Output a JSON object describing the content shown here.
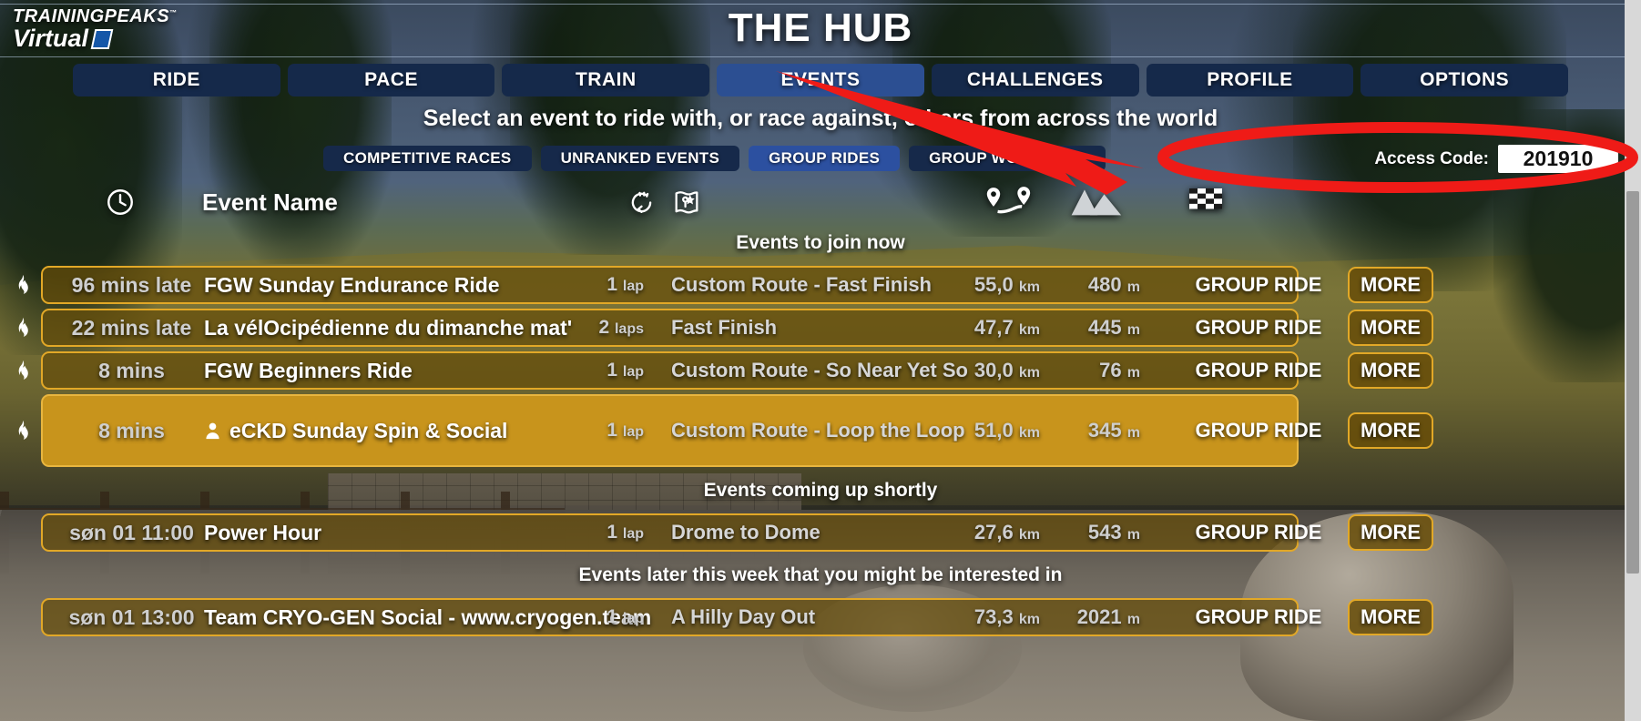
{
  "brand": {
    "name_top": "TRAININGPEAKS",
    "trademark": "™",
    "name_bottom": "Virtual",
    "mark_icon": "parallelogram-logo-mark"
  },
  "header": {
    "title": "THE HUB",
    "subtitle": "Select an event to ride with, or race against, others from across the world"
  },
  "nav": {
    "tabs": [
      {
        "label": "RIDE",
        "active": false
      },
      {
        "label": "PACE",
        "active": false
      },
      {
        "label": "TRAIN",
        "active": false
      },
      {
        "label": "EVENTS",
        "active": true
      },
      {
        "label": "CHALLENGES",
        "active": false
      },
      {
        "label": "PROFILE",
        "active": false
      },
      {
        "label": "OPTIONS",
        "active": false
      }
    ]
  },
  "filters": {
    "buttons": [
      {
        "label": "COMPETITIVE RACES",
        "active": false
      },
      {
        "label": "UNRANKED EVENTS",
        "active": false
      },
      {
        "label": "GROUP RIDES",
        "active": true
      },
      {
        "label": "GROUP WORKOUTS",
        "active": false
      }
    ]
  },
  "access_code": {
    "label": "Access Code:",
    "value": "201910",
    "placeholder": ""
  },
  "columns": {
    "time_icon": "clock-icon",
    "name": "Event Name",
    "laps_icon": "lap-loop-icon",
    "route_icon": "map-route-icon",
    "distance_icon": "distance-pins-icon",
    "elevation_icon": "mountain-elevation-icon",
    "type_icon": "checkered-flag-icon"
  },
  "sections": [
    {
      "heading": "Events to join now",
      "events": [
        {
          "time": "96 mins late",
          "name": "FGW Sunday Endurance Ride",
          "laps": "1",
          "laps_unit": "lap",
          "route": "Custom Route - Fast Finish",
          "distance": "55,0",
          "distance_unit": "km",
          "elevation": "480",
          "elevation_unit": "m",
          "type": "GROUP RIDE",
          "more": "MORE",
          "badge_icon": "flame-icon",
          "highlighted": false,
          "private": false
        },
        {
          "time": "22 mins late",
          "name": "La vélOcipédienne du dimanche mat'",
          "laps": "2",
          "laps_unit": "laps",
          "route": "Fast Finish",
          "distance": "47,7",
          "distance_unit": "km",
          "elevation": "445",
          "elevation_unit": "m",
          "type": "GROUP RIDE",
          "more": "MORE",
          "badge_icon": "flame-icon",
          "highlighted": false,
          "private": false
        },
        {
          "time": "8 mins",
          "name": "FGW Beginners Ride",
          "laps": "1",
          "laps_unit": "lap",
          "route": "Custom Route - So Near Yet So Far",
          "distance": "30,0",
          "distance_unit": "km",
          "elevation": "76",
          "elevation_unit": "m",
          "type": "GROUP RIDE",
          "more": "MORE",
          "badge_icon": "flame-icon",
          "highlighted": false,
          "private": false
        },
        {
          "time": "8 mins",
          "name": "eCKD Sunday Spin & Social",
          "laps": "1",
          "laps_unit": "lap",
          "route": "Custom Route - Loop the Loop",
          "distance": "51,0",
          "distance_unit": "km",
          "elevation": "345",
          "elevation_unit": "m",
          "type": "GROUP RIDE",
          "more": "MORE",
          "badge_icon": "flame-icon",
          "highlighted": true,
          "private": true,
          "private_icon": "person-icon"
        }
      ]
    },
    {
      "heading": "Events coming up shortly",
      "events": [
        {
          "time": "søn 01 11:00",
          "name": "Power Hour",
          "laps": "1",
          "laps_unit": "lap",
          "route": "Drome to Dome",
          "distance": "27,6",
          "distance_unit": "km",
          "elevation": "543",
          "elevation_unit": "m",
          "type": "GROUP RIDE",
          "more": "MORE",
          "badge_icon": "",
          "highlighted": false,
          "private": false
        }
      ]
    },
    {
      "heading": "Events later this week that you might be interested in",
      "events": [
        {
          "time": "søn 01 13:00",
          "name": "Team CRYO-GEN Social - www.cryogen.team",
          "laps": "1",
          "laps_unit": "lap",
          "route": "A Hilly Day Out",
          "distance": "73,3",
          "distance_unit": "km",
          "elevation": "2021",
          "elevation_unit": "m",
          "type": "GROUP RIDE",
          "more": "MORE",
          "badge_icon": "",
          "highlighted": false,
          "private": false
        }
      ]
    }
  ],
  "annotation": {
    "arrow_color": "#ef1b17",
    "ellipse_color": "#ef1b17",
    "arrow_icon": "red-arrow-annotation",
    "ellipse_icon": "red-ellipse-annotation"
  },
  "colors": {
    "nav_inactive": "#15294a",
    "nav_active": "#2c4f92",
    "filter_active": "#2c50a0",
    "row_border": "#e2a827",
    "row_highlight": "#c8941c"
  }
}
